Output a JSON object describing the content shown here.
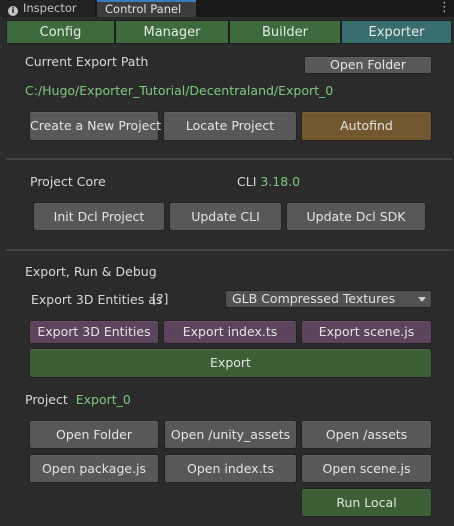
{
  "window_tabs": {
    "inspector": "Inspector",
    "control_panel": "Control Panel"
  },
  "mode_tabs": [
    "Config",
    "Manager",
    "Builder",
    "Exporter"
  ],
  "active_mode": "Exporter",
  "export_path": {
    "heading": "Current Export Path",
    "open_folder": "Open Folder",
    "path": "C:/Hugo/Exporter_Tutorial/Decentraland/Export_0",
    "create_project": "Create a New Project",
    "locate_project": "Locate Project",
    "autofind": "Autofind"
  },
  "project_core": {
    "heading": "Project Core",
    "cli_label": "CLI",
    "cli_version": "3.18.0",
    "init_dcl": "Init Dcl Project",
    "update_cli": "Update CLI",
    "update_sdk": "Update Dcl SDK"
  },
  "export_run": {
    "heading": "Export, Run & Debug",
    "entities_label": "Export 3D Entities as",
    "help": "[?]",
    "format_selected": "GLB Compressed Textures",
    "export_entities": "Export 3D Entities",
    "export_index": "Export index.ts",
    "export_scene": "Export scene.js",
    "export": "Export"
  },
  "project": {
    "label": "Project",
    "name": "Export_0",
    "open_folder": "Open Folder",
    "open_unity_assets": "Open /unity_assets",
    "open_assets": "Open /assets",
    "open_package": "Open package.js",
    "open_index": "Open index.ts",
    "open_scene": "Open scene.js",
    "run_local": "Run Local"
  }
}
